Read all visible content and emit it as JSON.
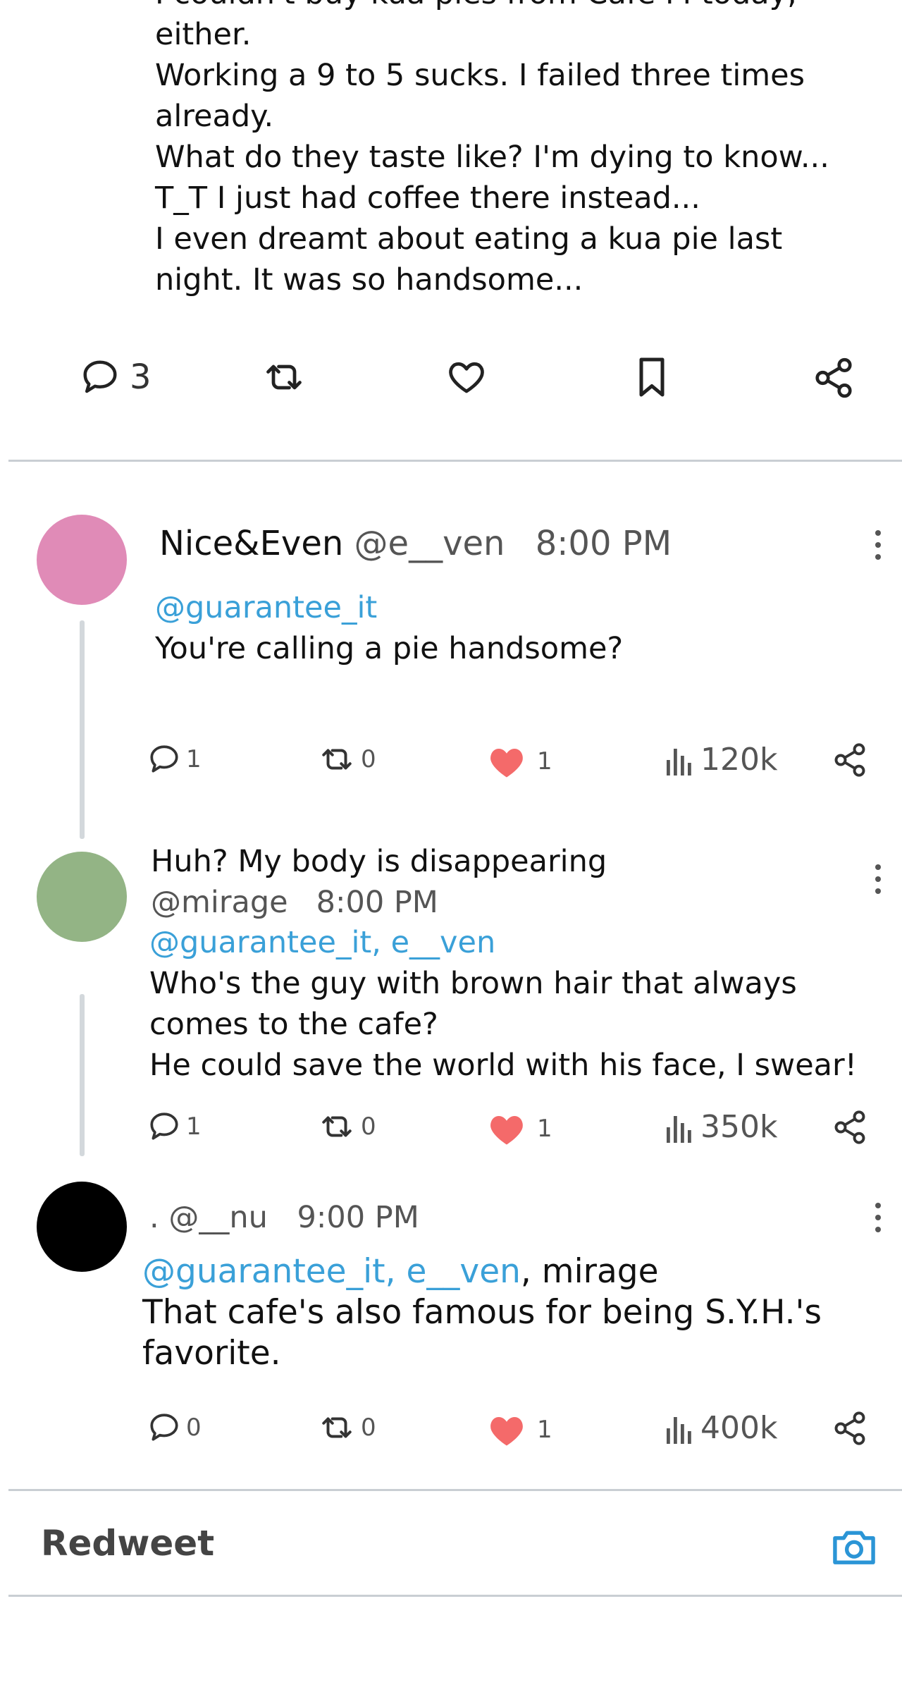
{
  "main_post": {
    "lines": [
      "I couldn't buy kua pies from Cafe M today,",
      "either.",
      "Working a 9 to 5 sucks. I failed three times",
      "already.",
      "What do they taste like? I'm dying to know...",
      "T_T I just had coffee there instead...",
      "I even dreamt about eating a kua pie last",
      "night. It was so handsome..."
    ],
    "actions": {
      "replies": "3"
    }
  },
  "replies": [
    {
      "display_name": "Nice&Even",
      "handle": "@e__ven",
      "time": "8:00 PM",
      "mention": "@guarantee_it",
      "mention_suffix": "",
      "text_lines": [
        "You're calling a pie handsome?"
      ],
      "stats": {
        "comments": "1",
        "retweets": "0",
        "likes": "1",
        "views": "120k"
      },
      "avatar_color": "#e08bb7"
    },
    {
      "display_name": "Huh? My body is disappearing",
      "handle": "@mirage",
      "time": "8:00 PM",
      "mention": "@guarantee_it, e__ven",
      "mention_suffix": "",
      "text_lines": [
        "Who's the guy with brown hair that always",
        "comes to the cafe?",
        "He could save the world with his face, I swear!"
      ],
      "stats": {
        "comments": "1",
        "retweets": "0",
        "likes": "1",
        "views": "350k"
      },
      "avatar_color": "#93b485"
    },
    {
      "display_name": ".",
      "handle": "@__nu",
      "time": "9:00 PM",
      "mention": "@guarantee_it, e__ven",
      "mention_suffix": ", mirage",
      "text_lines": [
        "That cafe's also famous for being S.Y.H.'s",
        "favorite."
      ],
      "stats": {
        "comments": "0",
        "retweets": "0",
        "likes": "1",
        "views": "400k"
      },
      "avatar_color": "#000000"
    }
  ],
  "composer": {
    "label": "Redweet",
    "camera_icon": "camera-icon"
  },
  "colors": {
    "mention": "#3aa0d8",
    "like": "#f46a6a",
    "divider": "#c9ced3",
    "thread_line": "#d3d8dc"
  }
}
